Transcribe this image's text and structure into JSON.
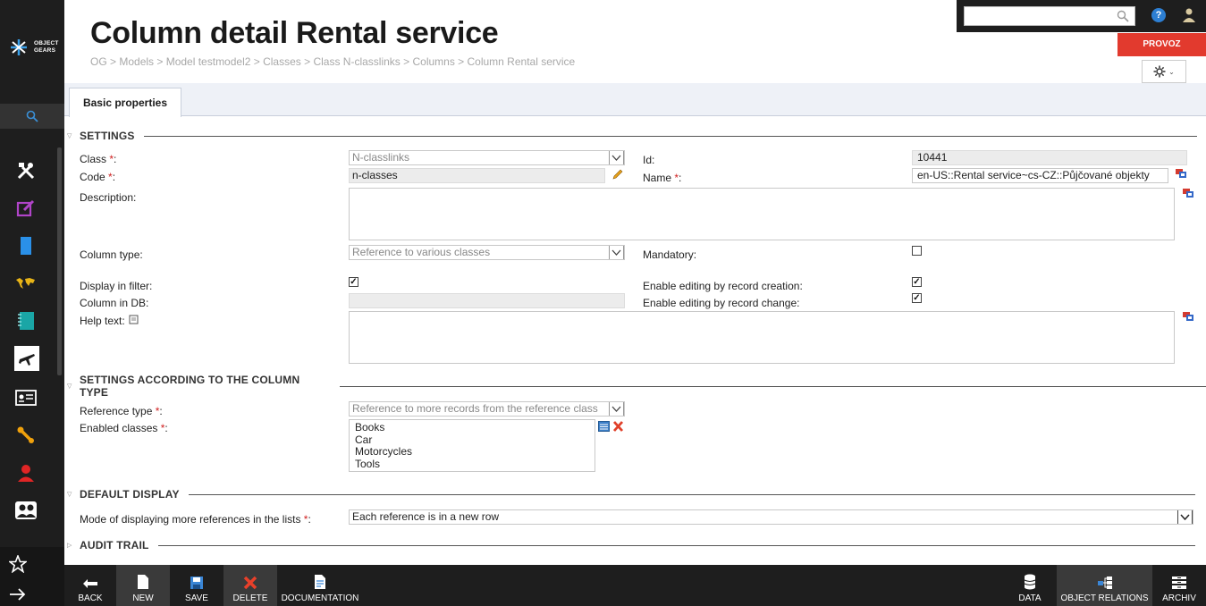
{
  "header": {
    "title": "Column detail Rental service",
    "breadcrumb": "OG > Models > Model testmodel2 > Classes > Class N-classlinks > Columns > Column Rental service",
    "logo_text_line1": "OBJECT",
    "logo_text_line2": "GEARS",
    "search_placeholder": "",
    "help_label": "?",
    "environment": "PROVOZ"
  },
  "tabs": [
    {
      "label": "Basic properties",
      "active": true
    }
  ],
  "sections": {
    "settings": "SETTINGS",
    "column_type_settings": "SETTINGS ACCORDING TO THE COLUMN TYPE",
    "default_display": "DEFAULT DISPLAY",
    "audit_trail": "AUDIT TRAIL"
  },
  "form": {
    "class_label": "Class ",
    "class_value": "N-classlinks",
    "code_label": "Code ",
    "code_value": "n-classes",
    "id_label": "Id:",
    "id_value": "10441",
    "name_label": "Name ",
    "name_value": "en-US::Rental service~cs-CZ::Půjčované objekty",
    "description_label": "Description:",
    "column_type_label": "Column type:",
    "column_type_value": "Reference to various classes",
    "mandatory_label": "Mandatory:",
    "mandatory_checked": false,
    "display_in_filter_label": "Display in filter:",
    "display_in_filter_checked": true,
    "column_in_db_label": "Column in DB:",
    "enable_edit_creation_label": "Enable editing by record creation:",
    "enable_edit_creation_checked": true,
    "enable_edit_change_label": "Enable editing by record change:",
    "enable_edit_change_checked": true,
    "help_text_label": "Help text:",
    "reference_type_label": "Reference type ",
    "reference_type_value": "Reference to more records from the reference class",
    "enabled_classes_label": "Enabled classes ",
    "enabled_classes": [
      "Books",
      "Car",
      "Motorcycles",
      "Tools"
    ],
    "display_mode_label": "Mode of displaying more references in the lists ",
    "display_mode_value": "Each reference is in a new row",
    "required_marker": "*",
    "colon": ":"
  },
  "toolbar": {
    "left": [
      {
        "label": "BACK",
        "icon": "back-icon"
      },
      {
        "label": "NEW",
        "icon": "new-document-icon"
      },
      {
        "label": "SAVE",
        "icon": "save-icon"
      },
      {
        "label": "DELETE",
        "icon": "delete-icon"
      },
      {
        "label": "DOCUMENTATION",
        "icon": "documentation-icon"
      }
    ],
    "right": [
      {
        "label": "DATA",
        "icon": "database-icon"
      },
      {
        "label": "OBJECT RELATIONS",
        "icon": "relations-icon"
      },
      {
        "label": "ARCHIV",
        "icon": "archive-icon"
      }
    ]
  },
  "colors": {
    "accent_red": "#e23a2e",
    "sidebar": "#1e1e1e",
    "help_blue": "#2d7fd3"
  }
}
